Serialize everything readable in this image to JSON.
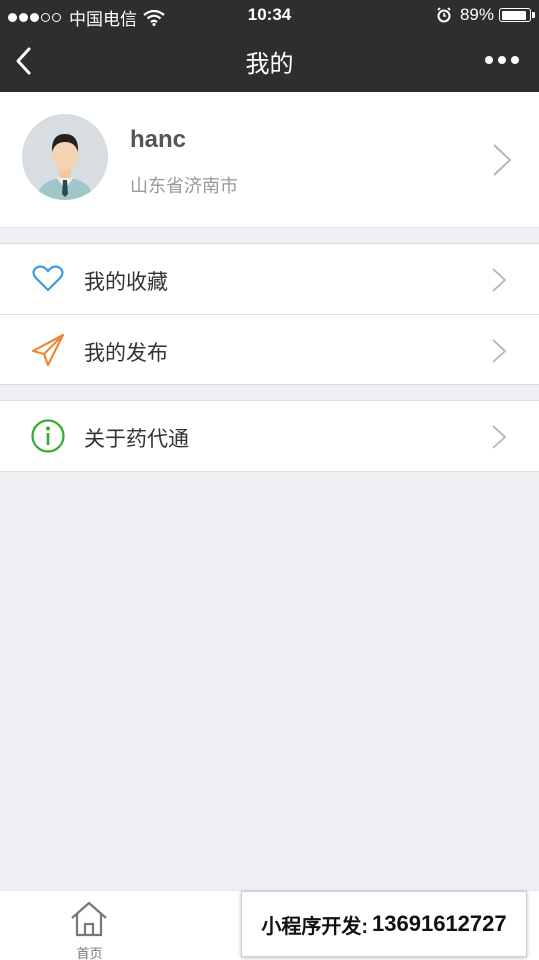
{
  "status_bar": {
    "carrier": "中国电信",
    "time": "10:34",
    "battery": "89%",
    "battery_level": 0.89,
    "signal_bars_filled": 3,
    "signal_bars_total": 5
  },
  "nav": {
    "title": "我的"
  },
  "profile": {
    "username": "hanc",
    "location": "山东省济南市"
  },
  "menu": [
    {
      "label": "我的收藏",
      "icon": "heart-icon",
      "color": "#3b9bd6"
    },
    {
      "label": "我的发布",
      "icon": "paper-plane-icon",
      "color": "#e98a3a"
    },
    {
      "label": "关于药代通",
      "icon": "info-icon",
      "color": "#2db02d"
    }
  ],
  "tabs": [
    {
      "label": "首页",
      "icon": "home-icon"
    }
  ],
  "promo": {
    "label": "小程序开发:",
    "phone": "13691612727"
  },
  "colors": {
    "nav_background": "#2e2e30",
    "page_background": "#efeff4"
  }
}
